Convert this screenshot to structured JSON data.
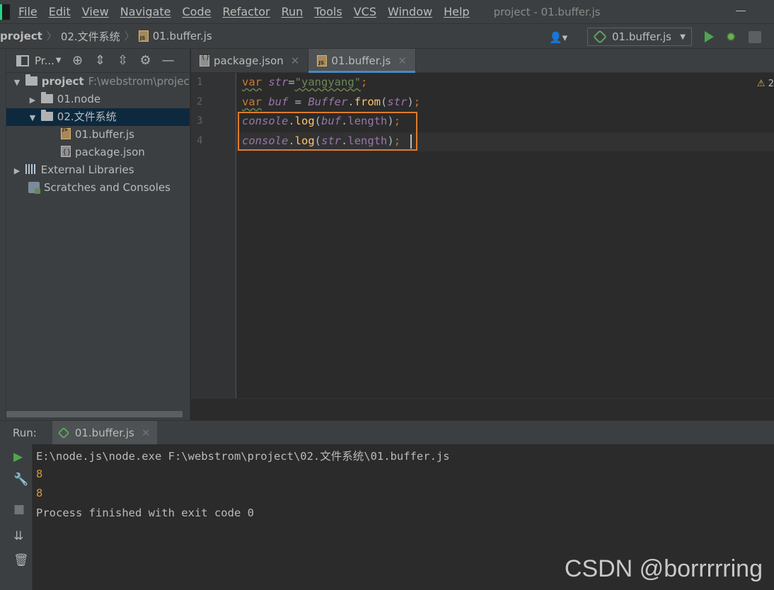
{
  "menubar": {
    "items": [
      "File",
      "Edit",
      "View",
      "Navigate",
      "Code",
      "Refactor",
      "Run",
      "Tools",
      "VCS",
      "Window",
      "Help"
    ],
    "window_title": "project - 01.buffer.js"
  },
  "navbar": {
    "breadcrumbs": [
      "project",
      "02.文件系统",
      "01.buffer.js"
    ],
    "run_config": "01.buffer.js"
  },
  "project_panel": {
    "title": "Pr...",
    "tree": [
      {
        "label": "project",
        "hint": "F:\\webstrom\\projec",
        "expanded": true
      },
      {
        "label": "01.node",
        "expanded": false
      },
      {
        "label": "02.文件系统",
        "expanded": true,
        "selected": true
      },
      {
        "label": "01.buffer.js"
      },
      {
        "label": "package.json"
      },
      {
        "label": "External Libraries",
        "expanded": false
      },
      {
        "label": "Scratches and Consoles"
      }
    ]
  },
  "editor": {
    "tabs": [
      {
        "label": "package.json",
        "active": false
      },
      {
        "label": "01.buffer.js",
        "active": true
      }
    ],
    "line_numbers": [
      "1",
      "2",
      "3",
      "4"
    ],
    "warning_count": "2",
    "code": {
      "line1": {
        "kw": "var",
        "var": "str",
        "eq": "=",
        "str": "\"yangyang\"",
        "semi": ";"
      },
      "line2": {
        "kw": "var",
        "var": "buf",
        "eq": " = ",
        "cls": "Buffer",
        "dot": ".",
        "fn": "from",
        "open": "(",
        "arg": "str",
        "close": ")",
        "semi": ";"
      },
      "line3": {
        "obj": "console",
        "dot1": ".",
        "fn": "log",
        "open": "(",
        "arg": "buf",
        "dot2": ".",
        "prop": "length",
        "close": ")",
        "semi": ";"
      },
      "line4": {
        "obj": "console",
        "dot1": ".",
        "fn": "log",
        "open": "(",
        "arg": "str",
        "dot2": ".",
        "prop": "length",
        "close": ")",
        "semi": ";"
      }
    }
  },
  "run_panel": {
    "label": "Run:",
    "tab_label": "01.buffer.js",
    "console": [
      "E:\\node.js\\node.exe F:\\webstrom\\project\\02.文件系统\\01.buffer.js",
      "8",
      "8",
      "Process finished with exit code 0"
    ]
  },
  "watermark": "CSDN @borrrrring",
  "colors": {
    "background": "#2b2b2b",
    "panel": "#3c3f41",
    "selection": "#0d293e",
    "highlight_box": "#e07b2a",
    "keyword": "#cc7832",
    "string": "#6a8759",
    "function": "#ffc66d",
    "variable": "#9876aa",
    "console_output": "#d09a3a"
  },
  "icons": [
    "app-logo-icon",
    "user-icon",
    "node-icon",
    "run-icon",
    "debug-icon",
    "coverage-icon",
    "project-panel-icon",
    "locate-icon",
    "expand-all-icon",
    "collapse-all-icon",
    "gear-icon",
    "minimize-icon",
    "folder-icon",
    "js-file-icon",
    "json-file-icon",
    "library-icon",
    "scratch-icon",
    "rerun-icon",
    "wrench-icon",
    "stop-icon",
    "scroll-to-end-icon",
    "trash-icon",
    "warning-icon"
  ]
}
